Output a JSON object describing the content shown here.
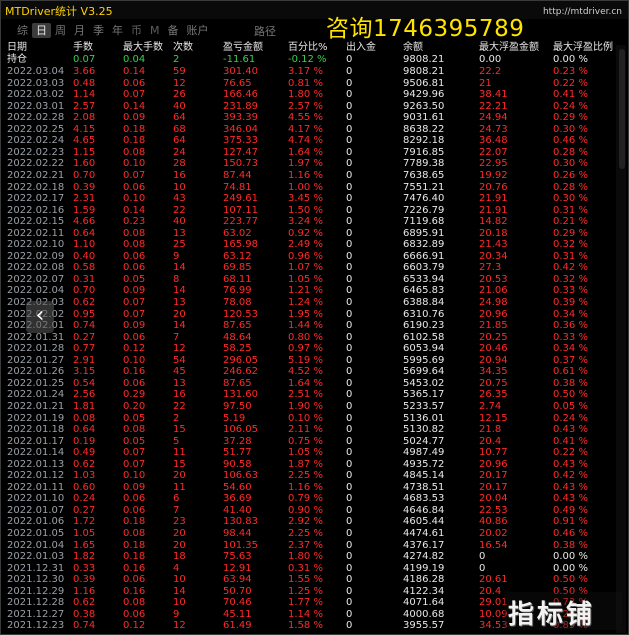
{
  "app": {
    "title": "MTDriver统计 V3.25",
    "url": "http://mtdriver.cn",
    "promo": "咨询1746395789",
    "watermark": "指标铺"
  },
  "tabs": [
    {
      "label": "综"
    },
    {
      "label": "日"
    },
    {
      "label": "周"
    },
    {
      "label": "月"
    },
    {
      "label": "季"
    },
    {
      "label": "年"
    },
    {
      "label": "币"
    },
    {
      "label": "M"
    },
    {
      "label": "备"
    },
    {
      "label": "账户"
    }
  ],
  "active_tab": "日",
  "path_label": "路径",
  "nav": {
    "prev": "‹"
  },
  "table": {
    "headers": [
      "日期",
      "手数",
      "最大手数",
      "次数",
      "盈亏金额",
      "百分比%",
      "出入金",
      "余额",
      "最大浮盈金额",
      "最大浮盈比例"
    ],
    "summary": [
      "持仓",
      "0.07",
      "0.04",
      "2",
      "-11.61",
      "-0.12 %",
      "0",
      "9808.21",
      "0.00",
      "0.00 %"
    ],
    "rows": [
      [
        "2022.03.04",
        "3.66",
        "0.14",
        "59",
        "301.40",
        "3.17 %",
        "0",
        "9808.21",
        "22.2",
        "0.23 %"
      ],
      [
        "2022.03.03",
        "0.48",
        "0.06",
        "12",
        "76.65",
        "0.81 %",
        "0",
        "9506.81",
        "21",
        "0.22 %"
      ],
      [
        "2022.03.02",
        "1.14",
        "0.07",
        "26",
        "166.46",
        "1.80 %",
        "0",
        "9429.96",
        "38.41",
        "0.41 %"
      ],
      [
        "2022.03.01",
        "2.57",
        "0.14",
        "40",
        "231.89",
        "2.57 %",
        "0",
        "9263.50",
        "22.21",
        "0.24 %"
      ],
      [
        "2022.02.28",
        "2.08",
        "0.09",
        "64",
        "393.39",
        "4.55 %",
        "0",
        "9031.61",
        "24.94",
        "0.29 %"
      ],
      [
        "2022.02.25",
        "4.15",
        "0.18",
        "68",
        "346.04",
        "4.17 %",
        "0",
        "8638.22",
        "24.73",
        "0.30 %"
      ],
      [
        "2022.02.24",
        "4.65",
        "0.18",
        "64",
        "375.33",
        "4.74 %",
        "0",
        "8292.18",
        "36.48",
        "0.46 %"
      ],
      [
        "2022.02.23",
        "1.15",
        "0.08",
        "24",
        "127.47",
        "1.64 %",
        "0",
        "7916.85",
        "22.07",
        "0.28 %"
      ],
      [
        "2022.02.22",
        "1.60",
        "0.10",
        "28",
        "150.73",
        "1.97 %",
        "0",
        "7789.38",
        "22.95",
        "0.30 %"
      ],
      [
        "2022.02.21",
        "0.70",
        "0.07",
        "16",
        "87.44",
        "1.16 %",
        "0",
        "7638.65",
        "19.92",
        "0.26 %"
      ],
      [
        "2022.02.18",
        "0.39",
        "0.06",
        "10",
        "74.81",
        "1.00 %",
        "0",
        "7551.21",
        "20.76",
        "0.28 %"
      ],
      [
        "2022.02.17",
        "2.31",
        "0.10",
        "43",
        "249.61",
        "3.45 %",
        "0",
        "7476.40",
        "21.91",
        "0.30 %"
      ],
      [
        "2022.02.16",
        "1.59",
        "0.14",
        "22",
        "107.11",
        "1.50 %",
        "0",
        "7226.79",
        "21.91",
        "0.31 %"
      ],
      [
        "2022.02.15",
        "4.66",
        "0.23",
        "40",
        "223.77",
        "3.24 %",
        "0",
        "7119.68",
        "14.82",
        "0.21 %"
      ],
      [
        "2022.02.11",
        "0.64",
        "0.08",
        "13",
        "63.02",
        "0.92 %",
        "0",
        "6895.91",
        "20.18",
        "0.29 %"
      ],
      [
        "2022.02.10",
        "1.10",
        "0.08",
        "25",
        "165.98",
        "2.49 %",
        "0",
        "6832.89",
        "21.43",
        "0.32 %"
      ],
      [
        "2022.02.09",
        "0.40",
        "0.06",
        "9",
        "63.12",
        "0.96 %",
        "0",
        "6666.91",
        "20.34",
        "0.31 %"
      ],
      [
        "2022.02.08",
        "0.58",
        "0.06",
        "14",
        "69.85",
        "1.07 %",
        "0",
        "6603.79",
        "27.3",
        "0.42 %"
      ],
      [
        "2022.02.07",
        "0.31",
        "0.05",
        "8",
        "68.11",
        "1.05 %",
        "0",
        "6533.94",
        "20.53",
        "0.32 %"
      ],
      [
        "2022.02.04",
        "0.70",
        "0.09",
        "14",
        "76.99",
        "1.21 %",
        "0",
        "6465.83",
        "21.06",
        "0.33 %"
      ],
      [
        "2022.02.03",
        "0.62",
        "0.07",
        "13",
        "78.08",
        "1.24 %",
        "0",
        "6388.84",
        "24.98",
        "0.39 %"
      ],
      [
        "2022.02.02",
        "0.95",
        "0.07",
        "20",
        "120.53",
        "1.95 %",
        "0",
        "6310.76",
        "20.96",
        "0.34 %"
      ],
      [
        "2022.02.01",
        "0.74",
        "0.09",
        "14",
        "87.65",
        "1.44 %",
        "0",
        "6190.23",
        "21.85",
        "0.36 %"
      ],
      [
        "2022.01.31",
        "0.27",
        "0.06",
        "7",
        "48.64",
        "0.80 %",
        "0",
        "6102.58",
        "20.25",
        "0.33 %"
      ],
      [
        "2022.01.28",
        "0.77",
        "0.12",
        "12",
        "58.25",
        "0.97 %",
        "0",
        "6053.94",
        "20.46",
        "0.34 %"
      ],
      [
        "2022.01.27",
        "2.91",
        "0.10",
        "54",
        "296.05",
        "5.19 %",
        "0",
        "5995.69",
        "20.94",
        "0.37 %"
      ],
      [
        "2022.01.26",
        "3.15",
        "0.16",
        "45",
        "246.62",
        "4.52 %",
        "0",
        "5699.64",
        "34.35",
        "0.61 %"
      ],
      [
        "2022.01.25",
        "0.54",
        "0.06",
        "13",
        "87.65",
        "1.64 %",
        "0",
        "5453.02",
        "20.75",
        "0.38 %"
      ],
      [
        "2022.01.24",
        "2.56",
        "0.29",
        "16",
        "131.60",
        "2.51 %",
        "0",
        "5365.17",
        "26.35",
        "0.50 %"
      ],
      [
        "2022.01.21",
        "1.81",
        "0.20",
        "22",
        "97.50",
        "1.90 %",
        "0",
        "5233.57",
        "2.74",
        "0.05 %"
      ],
      [
        "2022.01.19",
        "0.08",
        "0.05",
        "2",
        "5.19",
        "0.10 %",
        "0",
        "5136.01",
        "12.15",
        "0.24 %"
      ],
      [
        "2022.01.18",
        "0.64",
        "0.08",
        "15",
        "106.05",
        "2.11 %",
        "0",
        "5130.82",
        "21.8",
        "0.43 %"
      ],
      [
        "2022.01.17",
        "0.19",
        "0.05",
        "5",
        "37.28",
        "0.75 %",
        "0",
        "5024.77",
        "20.4",
        "0.41 %"
      ],
      [
        "2022.01.14",
        "0.49",
        "0.07",
        "11",
        "51.77",
        "1.05 %",
        "0",
        "4987.49",
        "10.77",
        "0.22 %"
      ],
      [
        "2022.01.13",
        "0.62",
        "0.07",
        "15",
        "90.58",
        "1.87 %",
        "0",
        "4935.72",
        "20.96",
        "0.43 %"
      ],
      [
        "2022.01.12",
        "1.03",
        "0.10",
        "20",
        "106.63",
        "2.25 %",
        "0",
        "4845.14",
        "20.17",
        "0.42 %"
      ],
      [
        "2022.01.11",
        "0.60",
        "0.09",
        "11",
        "54.60",
        "1.16 %",
        "0",
        "4738.51",
        "20.17",
        "0.43 %"
      ],
      [
        "2022.01.10",
        "0.24",
        "0.06",
        "6",
        "36.69",
        "0.79 %",
        "0",
        "4683.53",
        "20.04",
        "0.43 %"
      ],
      [
        "2022.01.07",
        "0.27",
        "0.06",
        "7",
        "41.40",
        "0.90 %",
        "0",
        "4646.84",
        "22.53",
        "0.49 %"
      ],
      [
        "2022.01.06",
        "1.72",
        "0.18",
        "23",
        "130.83",
        "2.92 %",
        "0",
        "4605.44",
        "40.86",
        "0.91 %"
      ],
      [
        "2022.01.05",
        "1.05",
        "0.08",
        "20",
        "98.44",
        "2.25 %",
        "0",
        "4474.61",
        "20.02",
        "0.46 %"
      ],
      [
        "2022.01.04",
        "1.65",
        "0.18",
        "20",
        "101.35",
        "2.37 %",
        "0",
        "4376.17",
        "16.54",
        "0.38 %"
      ],
      [
        "2022.01.03",
        "1.82",
        "0.18",
        "18",
        "75.63",
        "1.80 %",
        "0",
        "4274.82",
        "0",
        "0.00 %"
      ],
      [
        "2021.12.31",
        "0.33",
        "0.16",
        "4",
        "12.91",
        "0.31 %",
        "0",
        "4199.19",
        "0",
        "0.00 %"
      ],
      [
        "2021.12.30",
        "0.39",
        "0.06",
        "10",
        "63.94",
        "1.55 %",
        "0",
        "4186.28",
        "20.61",
        "0.50 %"
      ],
      [
        "2021.12.29",
        "1.16",
        "0.16",
        "14",
        "50.70",
        "1.25 %",
        "0",
        "4122.34",
        "20.4",
        "0.50 %"
      ],
      [
        "2021.12.28",
        "0.62",
        "0.08",
        "10",
        "70.46",
        "1.77 %",
        "0",
        "4071.64",
        "29.01",
        "0.73 %"
      ],
      [
        "2021.12.27",
        "0.38",
        "0.06",
        "9",
        "45.11",
        "1.14 %",
        "0",
        "4000.68",
        "10.09",
        "0.26 %"
      ],
      [
        "2021.12.23",
        "0.74",
        "0.12",
        "12",
        "61.49",
        "1.58 %",
        "0",
        "3955.57",
        "34.53",
        "0.89 %"
      ]
    ]
  }
}
